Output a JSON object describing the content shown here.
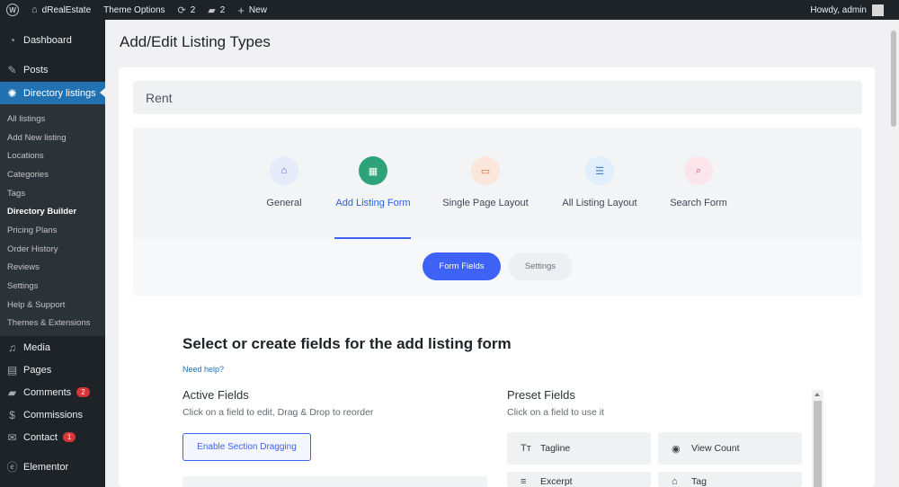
{
  "adminbar": {
    "site_name": "dRealEstate",
    "theme_options": "Theme Options",
    "updates_count": "2",
    "comments_count": "2",
    "new_label": "New",
    "howdy": "Howdy, admin"
  },
  "sidebar": {
    "top_items": [
      {
        "label": "Dashboard",
        "icon": "dashboard-icon"
      },
      {
        "label": "Posts",
        "icon": "pin-icon"
      },
      {
        "label": "Directory listings",
        "icon": "gear-icon"
      }
    ],
    "sub_items": [
      {
        "label": "All listings"
      },
      {
        "label": "Add New listing"
      },
      {
        "label": "Locations"
      },
      {
        "label": "Categories"
      },
      {
        "label": "Tags"
      },
      {
        "label": "Directory Builder"
      },
      {
        "label": "Pricing Plans"
      },
      {
        "label": "Order History"
      },
      {
        "label": "Reviews"
      },
      {
        "label": "Settings"
      },
      {
        "label": "Help & Support"
      },
      {
        "label": "Themes & Extensions"
      }
    ],
    "bottom_items": [
      {
        "label": "Media",
        "icon": "media-icon"
      },
      {
        "label": "Pages",
        "icon": "pages-icon"
      },
      {
        "label": "Comments",
        "icon": "comment-icon",
        "badge": "2"
      },
      {
        "label": "Commissions",
        "icon": "dollar-icon"
      },
      {
        "label": "Contact",
        "icon": "mail-icon",
        "badge": "1"
      },
      {
        "label": "Elementor",
        "icon": "elementor-icon"
      }
    ]
  },
  "page": {
    "title": "Add/Edit Listing Types",
    "listing_type_name": "Rent"
  },
  "builder_tabs": [
    {
      "label": "General",
      "icon": "home-icon"
    },
    {
      "label": "Add Listing Form",
      "icon": "form-icon"
    },
    {
      "label": "Single Page Layout",
      "icon": "layout-icon"
    },
    {
      "label": "All Listing Layout",
      "icon": "list-icon"
    },
    {
      "label": "Search Form",
      "icon": "search-icon"
    }
  ],
  "subtabs": {
    "form_fields": "Form Fields",
    "settings": "Settings"
  },
  "form_section": {
    "heading": "Select or create fields for the add listing form",
    "help_link": "Need help?",
    "active_title": "Active Fields",
    "active_subtitle": "Click on a field to edit, Drag & Drop to reorder",
    "enable_section_dragging": "Enable Section Dragging",
    "preset_title": "Preset Fields",
    "preset_subtitle": "Click on a field to use it",
    "preset_fields": [
      {
        "label": "Tagline",
        "icon": "text-icon"
      },
      {
        "label": "View Count",
        "icon": "eye-icon"
      },
      {
        "label": "Excerpt",
        "icon": "lines-icon"
      },
      {
        "label": "Tag",
        "icon": "tag-icon"
      }
    ]
  },
  "colors": {
    "accent": "#3e62f5",
    "wp_blue": "#2271b1",
    "admin_dark": "#1d2327"
  }
}
